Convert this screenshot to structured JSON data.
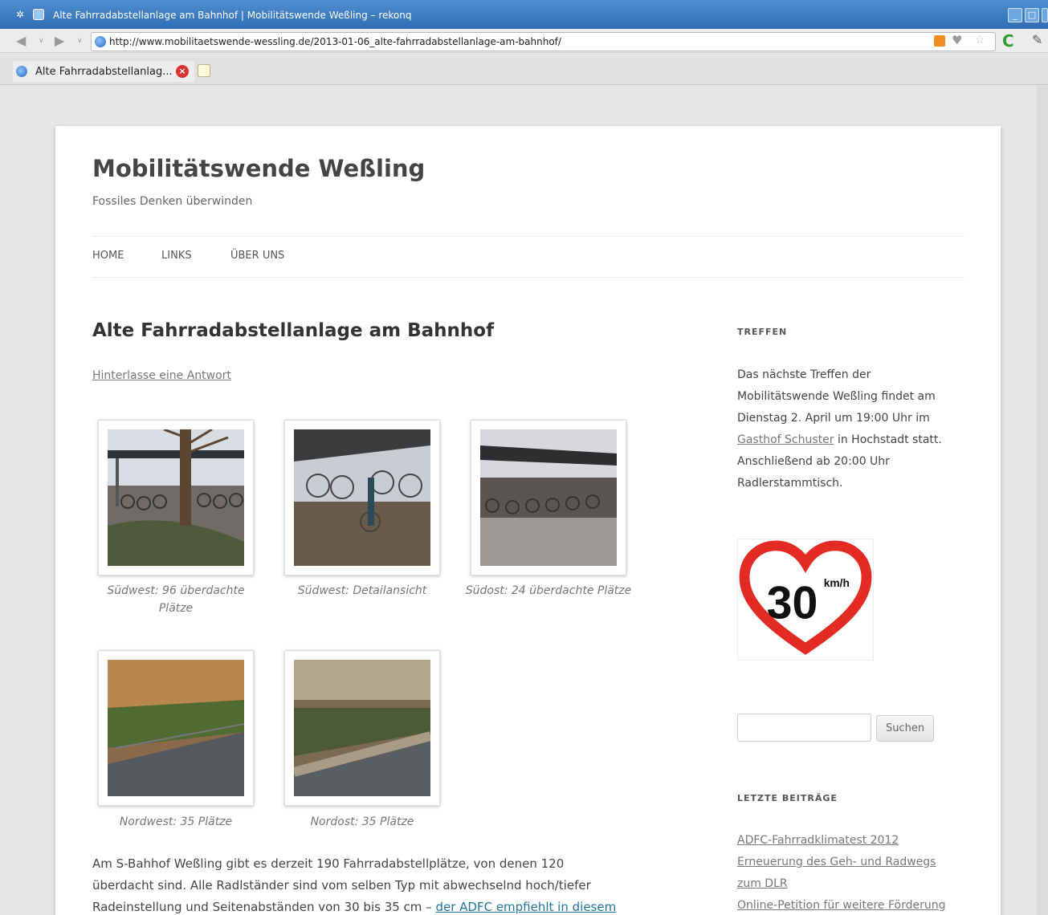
{
  "window": {
    "title": "Alte Fahrradabstellanlage am Bahnhof | Mobilitätswende Weßling – rekonq"
  },
  "browser": {
    "url": "http://www.mobilitaetswende-wessling.de/2013-01-06_alte-fahrradabstellanlage-am-bahnhof/",
    "tab_label": "Alte Fahrradabstellanlag...",
    "icons": [
      "back-icon",
      "forward-icon",
      "globe-icon",
      "rss-icon",
      "heart-icon",
      "star-icon",
      "reload-icon",
      "tools-icon",
      "close-tab-icon",
      "new-tab-icon"
    ]
  },
  "site": {
    "title": "Mobilitätswende Weßling",
    "description": "Fossiles Denken überwinden"
  },
  "menu": {
    "items": [
      "HOME",
      "LINKS",
      "ÜBER UNS"
    ]
  },
  "post": {
    "title": "Alte Fahrradabstellanlage am Bahnhof",
    "reply": "Hinterlasse eine Antwort",
    "gallery": [
      {
        "caption_line1": "Südwest: 96 überdachte",
        "caption_line2": "Plätze"
      },
      {
        "caption_line1": "Südwest: Detailansicht",
        "caption_line2": ""
      },
      {
        "caption_line1": "Südost: 24 überdachte Plätze",
        "caption_line2": ""
      },
      {
        "caption_line1": "Nordwest: 35 Plätze",
        "caption_line2": ""
      },
      {
        "caption_line1": "Nordost: 35 Plätze",
        "caption_line2": ""
      }
    ],
    "body": {
      "line1": "Am S-Bahhof Weßling gibt es derzeit 190 Fahrradabstellplätze, von denen 120",
      "line2": "überdacht sind. Alle Radlständer sind vom selben Typ mit abwechselnd hoch/tiefer",
      "line3_text": "Radeinstellung und Seitenabständen von 30 bis 35 cm – ",
      "line3_link": "der ADFC empfiehlt in diesem"
    }
  },
  "sidebar": {
    "meeting": {
      "title": "TREFFEN",
      "line1": "Das nächste Treffen der",
      "line2": "Mobilitätswende Weßling findet am",
      "line3": "Dienstag 2. April um 19:00 Uhr im",
      "line4_link": "Gasthof Schuster",
      "line4_text": " in Hochstadt statt.",
      "line5": "Anschließend ab 20:00 Uhr",
      "line6": "Radlerstammtisch."
    },
    "badge": {
      "number": "30",
      "unit": "km/h",
      "color": "#e32b24"
    },
    "search": {
      "button": "Suchen",
      "placeholder": ""
    },
    "recent": {
      "title": "LETZTE BEITRÄGE",
      "items": [
        "ADFC-Fahrradklimatest 2012",
        "Erneuerung des Geh- und Radwegs",
        "zum DLR",
        "Online-Petition für weitere Förderung"
      ]
    }
  }
}
